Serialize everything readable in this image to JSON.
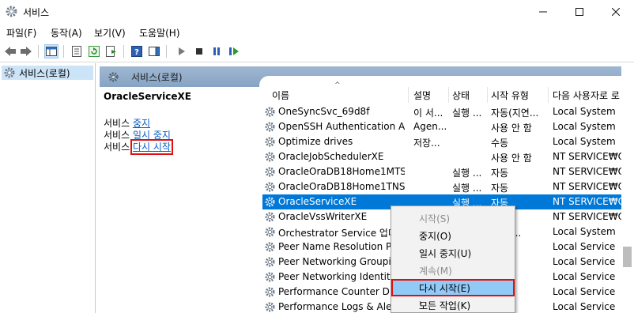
{
  "window": {
    "title": "서비스"
  },
  "menu": [
    "파일(F)",
    "동작(A)",
    "보기(V)",
    "도움말(H)"
  ],
  "tree": {
    "root_label": "서비스(로컬)"
  },
  "pane": {
    "header_label": "서비스(로컬)"
  },
  "detail": {
    "service_name": "OracleServiceXE",
    "lines": [
      {
        "prefix": "서비스 ",
        "link": "중지"
      },
      {
        "prefix": "서비스 ",
        "link": "일시 중지"
      },
      {
        "prefix": "서비스 ",
        "link": "다시 시작"
      }
    ]
  },
  "columns": [
    "이름",
    "설명",
    "상태",
    "시작 유형",
    "다음 사용자로 로"
  ],
  "rows": [
    {
      "name": "OneSyncSvc_69d8f",
      "desc": "이 서...",
      "status": "실행 ...",
      "startup": "자동(지연...",
      "logon": "Local System"
    },
    {
      "name": "OpenSSH Authentication A...",
      "desc": "Agen...",
      "status": "",
      "startup": "사용 안 함",
      "logon": "Local System"
    },
    {
      "name": "Optimize drives",
      "desc": "저장...",
      "status": "",
      "startup": "수동",
      "logon": "Local System"
    },
    {
      "name": "OracleJobSchedulerXE",
      "desc": "",
      "status": "",
      "startup": "사용 안 함",
      "logon": "NT SERVICE₩Or"
    },
    {
      "name": "OracleOraDB18Home1MTS...",
      "desc": "",
      "status": "실행 ...",
      "startup": "자동",
      "logon": "NT SERVICE₩Or"
    },
    {
      "name": "OracleOraDB18Home1TNS...",
      "desc": "",
      "status": "실행 ...",
      "startup": "자동",
      "logon": "NT SERVICE₩Or"
    },
    {
      "name": "OracleServiceXE",
      "desc": "",
      "status": "실행 ...",
      "startup": "자동",
      "logon": "NT SERVICE₩Or",
      "selected": true
    },
    {
      "name": "OracleVssWriterXE",
      "desc": "",
      "status": "",
      "startup": "",
      "logon": "NT SERVICE₩Or"
    },
    {
      "name": "Orchestrator Service 업데",
      "desc": "",
      "status": "",
      "startup": "(지연...",
      "logon": "Local System"
    },
    {
      "name": "Peer Name Resolution Pr",
      "desc": "",
      "status": "",
      "startup": "",
      "logon": "Local Service"
    },
    {
      "name": "Peer Networking Groupin",
      "desc": "",
      "status": "",
      "startup": "",
      "logon": "Local Service"
    },
    {
      "name": "Peer Networking Identity",
      "desc": "",
      "status": "",
      "startup": "",
      "logon": "Local Service"
    },
    {
      "name": "Performance Counter DL",
      "desc": "",
      "status": "",
      "startup": "",
      "logon": "Local Service"
    },
    {
      "name": "Performance Logs & Aler",
      "desc": "",
      "status": "",
      "startup": "",
      "logon": "Local Service"
    }
  ],
  "context_menu": [
    {
      "label": "시작(S)",
      "disabled": true
    },
    {
      "label": "중지(O)"
    },
    {
      "label": "일시 중지(U)"
    },
    {
      "label": "계속(M)",
      "disabled": true
    },
    {
      "label": "다시 시작(E)",
      "highlighted": true
    },
    {
      "label": "모든 작업(K)",
      "submenu": true
    }
  ],
  "colors": {
    "selection": "#0078d7",
    "highlight_box": "#e01010",
    "pane_header": "#9fb7d1",
    "link": "#0b5ec3"
  }
}
